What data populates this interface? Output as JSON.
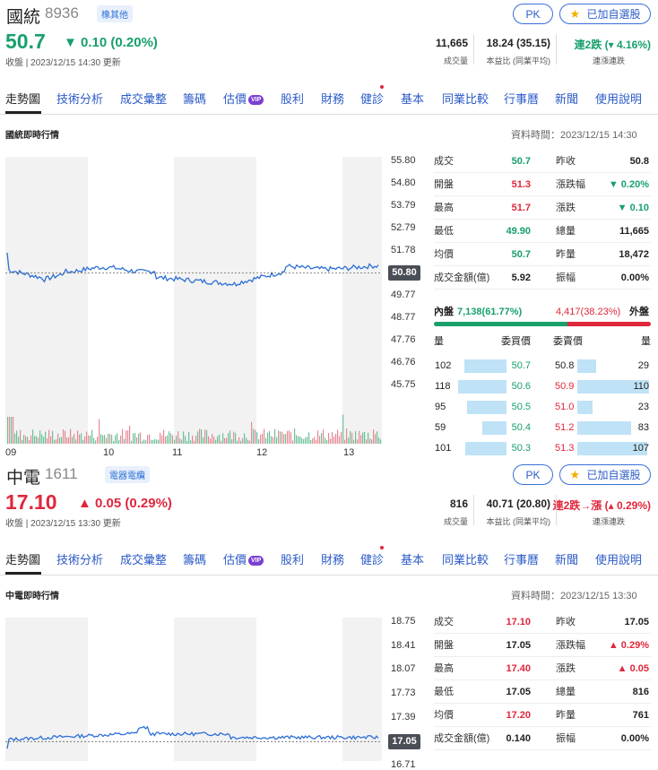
{
  "stocks": [
    {
      "name": "國統",
      "code": "8936",
      "tag": "橡其他",
      "price": "50.7",
      "change": "▼ 0.10 (0.20%)",
      "direction": "down",
      "updated": "收盤 | 2023/12/15 14:30 更新",
      "pk_label": "PK",
      "watch_label": "已加自選股",
      "stats": [
        {
          "value": "11,665",
          "label": "成交量"
        },
        {
          "value": "18.24 (35.15)",
          "label": "本益比 (同業平均)"
        },
        {
          "value": "連2跌 (▾ 4.16%)",
          "label": "連漲連跌",
          "color": "#18a06b"
        }
      ],
      "tabs": [
        "走勢圖",
        "技術分析",
        "成交彙整",
        "籌碼",
        "估價",
        "股利",
        "財務",
        "健診",
        "基本",
        "同業比較",
        "行事曆",
        "新聞",
        "使用說明"
      ],
      "vip_label": "VIP",
      "section_title": "國統即時行情",
      "data_time": "資料時間：2023/12/15 14:30",
      "yticks": [
        "55.80",
        "54.80",
        "53.79",
        "52.79",
        "51.78",
        "50.80",
        "49.77",
        "48.77",
        "47.76",
        "46.76",
        "45.75"
      ],
      "current_tag": "50.80",
      "xticks": [
        "09",
        "10",
        "11",
        "12",
        "13"
      ],
      "quotes_left": [
        {
          "label": "成交",
          "value": "50.7",
          "c": "dn"
        },
        {
          "label": "開盤",
          "value": "51.3",
          "c": "up"
        },
        {
          "label": "最高",
          "value": "51.7",
          "c": "up"
        },
        {
          "label": "最低",
          "value": "49.90",
          "c": "dn"
        },
        {
          "label": "均價",
          "value": "50.7",
          "c": "dn"
        },
        {
          "label": "成交金額(億)",
          "value": "5.92",
          "c": "nu"
        }
      ],
      "quotes_right": [
        {
          "label": "昨收",
          "value": "50.8",
          "c": "nu"
        },
        {
          "label": "漲跌幅",
          "value": "▼ 0.20%",
          "c": "dn"
        },
        {
          "label": "漲跌",
          "value": "▼ 0.10",
          "c": "dn"
        },
        {
          "label": "總量",
          "value": "11,665",
          "c": "nu"
        },
        {
          "label": "昨量",
          "value": "18,472",
          "c": "nu"
        },
        {
          "label": "振幅",
          "value": "0.00%",
          "c": "nu"
        }
      ],
      "inner_label": "內盤",
      "inner_value": "7,138(61.77%)",
      "outer_label": "外盤",
      "outer_value": "4,417(38.23%)",
      "inner_pct": 61.77,
      "ob_headers": [
        "量",
        "委買價",
        "委賣價",
        "量"
      ],
      "bids": [
        {
          "vol": "102",
          "price": "50.7",
          "c": "dn",
          "f": 0.59
        },
        {
          "vol": "118",
          "price": "50.6",
          "c": "dn",
          "f": 0.68
        },
        {
          "vol": "95",
          "price": "50.5",
          "c": "dn",
          "f": 0.55
        },
        {
          "vol": "59",
          "price": "50.4",
          "c": "dn",
          "f": 0.34
        },
        {
          "vol": "101",
          "price": "50.3",
          "c": "dn",
          "f": 0.58
        }
      ],
      "asks": [
        {
          "vol": "29",
          "price": "50.8",
          "c": "nu",
          "f": 0.26
        },
        {
          "vol": "110",
          "price": "50.9",
          "c": "up",
          "f": 1.0
        },
        {
          "vol": "23",
          "price": "51.0",
          "c": "up",
          "f": 0.21
        },
        {
          "vol": "83",
          "price": "51.2",
          "c": "up",
          "f": 0.75
        },
        {
          "vol": "107",
          "price": "51.3",
          "c": "up",
          "f": 0.97
        }
      ]
    },
    {
      "name": "中電",
      "code": "1611",
      "tag": "電器電纜",
      "price": "17.10",
      "change": "▲ 0.05 (0.29%)",
      "direction": "up",
      "updated": "收盤 | 2023/12/15 13:30 更新",
      "pk_label": "PK",
      "watch_label": "已加自選股",
      "stats": [
        {
          "value": "816",
          "label": "成交量"
        },
        {
          "value": "40.71 (20.80)",
          "label": "本益比 (同業平均)"
        },
        {
          "value": "連2跌→漲 (▴ 0.29%)",
          "label": "連漲連跌",
          "color": "#e0273c"
        }
      ],
      "tabs": [
        "走勢圖",
        "技術分析",
        "成交彙整",
        "籌碼",
        "估價",
        "股利",
        "財務",
        "健診",
        "基本",
        "同業比較",
        "行事曆",
        "新聞",
        "使用說明"
      ],
      "vip_label": "VIP",
      "section_title": "中電即時行情",
      "data_time": "資料時間：2023/12/15 13:30",
      "yticks": [
        "18.75",
        "18.41",
        "18.07",
        "17.73",
        "17.39",
        "17.05",
        "16.71"
      ],
      "current_tag": "17.05",
      "xticks": [],
      "quotes_left": [
        {
          "label": "成交",
          "value": "17.10",
          "c": "up"
        },
        {
          "label": "開盤",
          "value": "17.05",
          "c": "nu"
        },
        {
          "label": "最高",
          "value": "17.40",
          "c": "up"
        },
        {
          "label": "最低",
          "value": "17.05",
          "c": "nu"
        },
        {
          "label": "均價",
          "value": "17.20",
          "c": "up"
        },
        {
          "label": "成交金額(億)",
          "value": "0.140",
          "c": "nu"
        }
      ],
      "quotes_right": [
        {
          "label": "昨收",
          "value": "17.05",
          "c": "nu"
        },
        {
          "label": "漲跌幅",
          "value": "▲ 0.29%",
          "c": "up"
        },
        {
          "label": "漲跌",
          "value": "▲ 0.05",
          "c": "up"
        },
        {
          "label": "總量",
          "value": "816",
          "c": "nu"
        },
        {
          "label": "昨量",
          "value": "761",
          "c": "nu"
        },
        {
          "label": "振幅",
          "value": "0.00%",
          "c": "nu"
        }
      ]
    }
  ],
  "colors": {
    "up": "#e0273c",
    "down": "#18a06b",
    "line": "#2c6fd6",
    "link": "#2c5bc8"
  }
}
